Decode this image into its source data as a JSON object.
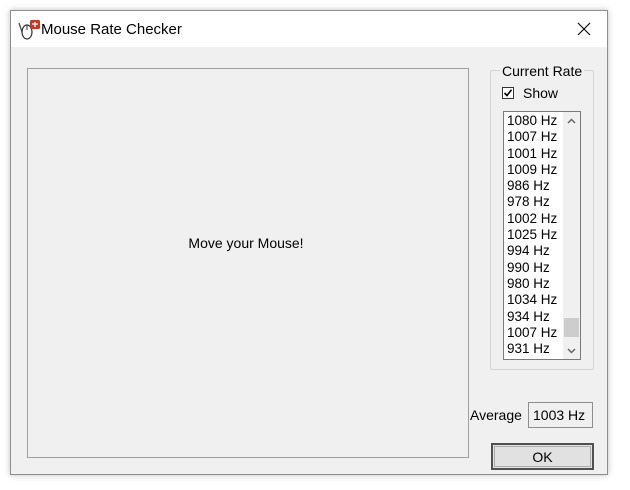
{
  "window": {
    "title": "Mouse Rate Checker",
    "app_icon": "mouse-rate-icon",
    "close_icon": "close-icon"
  },
  "tracking_area": {
    "prompt": "Move your Mouse!"
  },
  "current_rate": {
    "group_title": "Current Rate",
    "show_label": "Show",
    "show_checked": true,
    "rates": [
      "1080 Hz",
      "1007 Hz",
      "1001 Hz",
      "1009 Hz",
      "986 Hz",
      "978 Hz",
      "1002 Hz",
      "1025 Hz",
      "994 Hz",
      "990 Hz",
      "980 Hz",
      "1034 Hz",
      "934 Hz",
      "1007 Hz",
      "931 Hz"
    ]
  },
  "average": {
    "label": "Average",
    "value": "1003 Hz"
  },
  "ok_button": {
    "label": "OK"
  },
  "colors": {
    "window_bg": "#f0f0f0",
    "titlebar_bg": "#ffffff",
    "icon_red": "#c0392b"
  }
}
